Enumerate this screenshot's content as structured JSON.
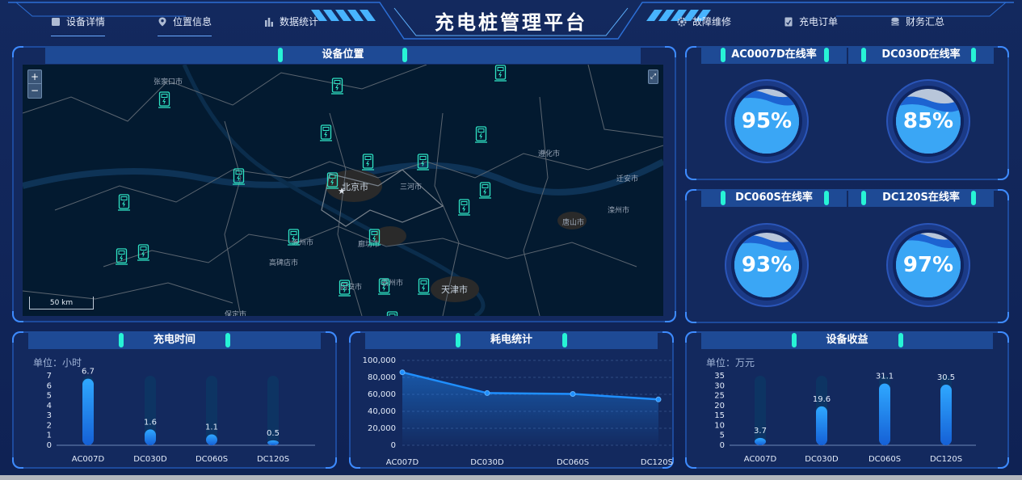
{
  "header": {
    "title": "充电桩管理平台",
    "nav_left": [
      {
        "label": "设备详情",
        "icon": "document-icon",
        "active": true
      },
      {
        "label": "位置信息",
        "icon": "location-pin-icon",
        "active": true
      },
      {
        "label": "数据统计",
        "icon": "bar-chart-icon",
        "active": false
      }
    ],
    "nav_right": [
      {
        "label": "故障维修",
        "icon": "gear-icon"
      },
      {
        "label": "充电订单",
        "icon": "order-icon"
      },
      {
        "label": "财务汇总",
        "icon": "database-icon"
      }
    ]
  },
  "map_panel": {
    "title": "设备位置",
    "zoom_in": "+",
    "zoom_out": "−",
    "fullscreen": "⤢",
    "scale": "50 km",
    "labels": [
      "张家口市",
      "北京市",
      "三河市",
      "天津市",
      "唐山市",
      "廊坊市",
      "保定市",
      "固安市",
      "涿州市",
      "遵化市",
      "迁安市",
      "滦州市",
      "高碑店市",
      "霸州市"
    ]
  },
  "online_panels": [
    {
      "titles": [
        "AC0007D在线率",
        "DC030D在线率"
      ],
      "values": [
        "95%",
        "85%"
      ],
      "levels": [
        0.95,
        0.85
      ]
    },
    {
      "titles": [
        "DC060S在线率",
        "DC120S在线率"
      ],
      "values": [
        "93%",
        "97%"
      ],
      "levels": [
        0.93,
        0.97
      ]
    }
  ],
  "colors": {
    "accent": "#27f3d6",
    "bar": "#2fa8ff",
    "line": "#1f8fff",
    "panel_border": "#1d4a9c"
  },
  "chart_data": [
    {
      "type": "bar",
      "title": "充电时间",
      "ylabel": "单位：小时",
      "categories": [
        "AC007D",
        "DC030D",
        "DC060S",
        "DC120S"
      ],
      "values": [
        6.7,
        1.6,
        1.1,
        0.5
      ],
      "value_labels": [
        "6.7",
        "1.6",
        "1.1",
        "0.5"
      ],
      "yticks": [
        "7",
        "6",
        "5",
        "4",
        "3",
        "2",
        "1",
        "0"
      ],
      "ylim": [
        0,
        7
      ]
    },
    {
      "type": "line",
      "title": "耗电统计",
      "categories": [
        "AC007D",
        "DC030D",
        "DC060S",
        "DC120S"
      ],
      "values": [
        86000,
        61500,
        60500,
        54000
      ],
      "yticks": [
        "100,000",
        "80,000",
        "60,000",
        "40,000",
        "20,000",
        "0"
      ],
      "ylim": [
        0,
        100000
      ]
    },
    {
      "type": "bar",
      "title": "设备收益",
      "ylabel": "单位：万元",
      "categories": [
        "AC007D",
        "DC030D",
        "DC060S",
        "DC120S"
      ],
      "values": [
        3.7,
        19.6,
        31.1,
        30.5
      ],
      "value_labels": [
        "3.7",
        "19.6",
        "31.1",
        "30.5"
      ],
      "yticks": [
        "35",
        "30",
        "25",
        "20",
        "15",
        "10",
        "5",
        "0"
      ],
      "ylim": [
        0,
        35
      ]
    }
  ]
}
